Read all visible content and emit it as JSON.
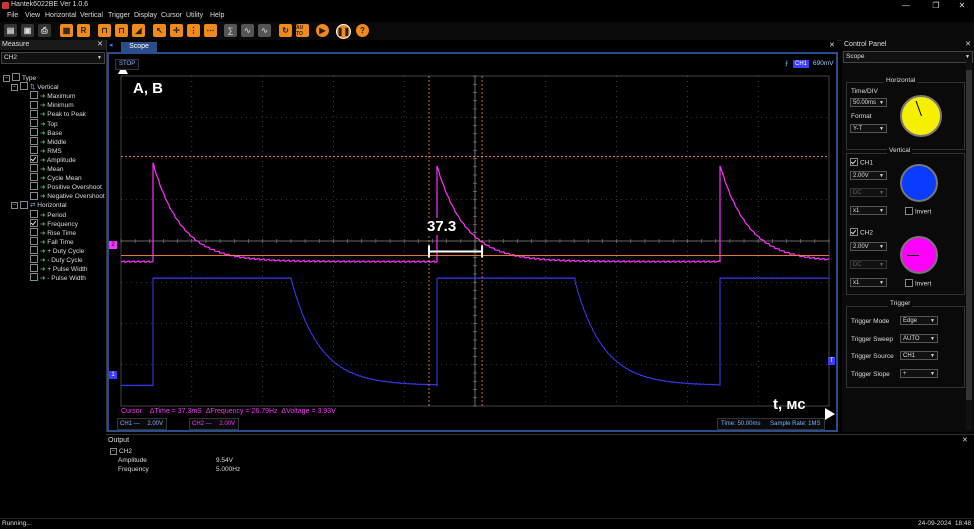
{
  "window": {
    "title": "Hantek6022BE Ver 1.0.6",
    "min": "—",
    "max": "❐",
    "close": "✕"
  },
  "menu": [
    "File",
    "View",
    "Horizontal",
    "Vertical",
    "Trigger",
    "Display",
    "Cursor",
    "Utility",
    "Help"
  ],
  "toolbar": {
    "r_label": "R",
    "auto_label": "AU TO",
    "help_label": "?"
  },
  "measure_panel": {
    "header": "Measure",
    "close": "✕",
    "channel": "CH2",
    "type_label": "Type",
    "vertical_label": "Vertical",
    "horizontal_label": "Horizontal",
    "vertical_items": [
      {
        "label": "Maximum",
        "checked": false
      },
      {
        "label": "Minimum",
        "checked": false
      },
      {
        "label": "Peak to Peak",
        "checked": false
      },
      {
        "label": "Top",
        "checked": false
      },
      {
        "label": "Base",
        "checked": false
      },
      {
        "label": "Middle",
        "checked": false
      },
      {
        "label": "RMS",
        "checked": false
      },
      {
        "label": "Amplitude",
        "checked": true
      },
      {
        "label": "Mean",
        "checked": false
      },
      {
        "label": "Cycle Mean",
        "checked": false
      },
      {
        "label": "Positive Overshoot",
        "checked": false
      },
      {
        "label": "Negative Overshoot",
        "checked": false
      }
    ],
    "horizontal_items": [
      {
        "label": "Period",
        "checked": false
      },
      {
        "label": "Frequency",
        "checked": true
      },
      {
        "label": "Rise Time",
        "checked": false
      },
      {
        "label": "Fall Time",
        "checked": false
      },
      {
        "label": "+ Duty Cycle",
        "checked": false
      },
      {
        "label": "- Duty Cycle",
        "checked": false
      },
      {
        "label": "+ Pulse Width",
        "checked": false
      },
      {
        "label": "- Pulse Width",
        "checked": false
      }
    ]
  },
  "scope": {
    "tab": "Scope",
    "close": "✕",
    "status": "STOP",
    "trigger_channel": "CH1",
    "trigger_level": "690mV",
    "annotation_y": "A, B",
    "annotation_x": "t, мс",
    "annotation_interval": "37.3",
    "cursor_readout": "Cursor    ΔTime = 37.3mS  ΔFrequency = 26.79Hz  ΔVoltage = 3.93V",
    "ch1_label": "CH1 —",
    "ch1_scale": "2.00V",
    "ch2_label": "CH2 —",
    "ch2_scale": "2.00V",
    "time_label": "Time: 50.00ms",
    "sample_rate_label": "Sample Rate: 1MS",
    "ch2_marker": "2",
    "ch1_marker": "1",
    "trig_marker": "T"
  },
  "control_panel": {
    "header": "Control Panel",
    "close": "✕",
    "mode": "Scope",
    "horizontal": {
      "title": "Horizontal",
      "time_div_label": "Time/DIV",
      "time_div": "50.00ms",
      "format_label": "Format",
      "format": "Y-T",
      "knob_color": "#f5f000"
    },
    "vertical": {
      "title": "Vertical",
      "ch1": {
        "label": "CH1",
        "enabled": true,
        "volts": "2.00V",
        "coupling": "DC",
        "probe": "x1",
        "invert_label": "Invert",
        "knob_color": "#0a3cff"
      },
      "ch2": {
        "label": "CH2",
        "enabled": true,
        "volts": "2.00V",
        "coupling": "DC",
        "probe": "x1",
        "invert_label": "Invert",
        "knob_color": "#ff00ff"
      }
    },
    "trigger": {
      "title": "Trigger",
      "mode_label": "Trigger Mode",
      "mode": "Edge",
      "sweep_label": "Trigger Sweep",
      "sweep": "AUTO",
      "source_label": "Trigger Source",
      "source": "CH1",
      "slope_label": "Trigger Slope",
      "slope": "+"
    }
  },
  "output": {
    "header": "Output",
    "close": "✕",
    "channel": "CH2",
    "rows": [
      {
        "name": "Amplitude",
        "value": "9.54V"
      },
      {
        "name": "Frequency",
        "value": "5.000Hz"
      }
    ]
  },
  "status_bar": {
    "text": "Running...",
    "timestamp": "24-09-2024  18:48"
  },
  "colors": {
    "ch1": "#3c3cff",
    "ch2": "#ff30ff",
    "cursor": "#ff8a3c",
    "frame": "#2c4d8c",
    "accent": "#f08a1a"
  },
  "chart_data": {
    "type": "line",
    "xlabel": "t, мс",
    "ylabel": "A, B",
    "x_divisions": 10,
    "y_divisions": 8,
    "series": [
      {
        "name": "CH2",
        "shape": "decaying exponential spikes",
        "period_divisions": 4,
        "edges": [
          0.45,
          4.35,
          8.25
        ],
        "amplitude_divisions": 2.4,
        "tau_divisions": 0.4
      },
      {
        "name": "CH1",
        "shape": "square wave with exponential rise",
        "period_divisions": 4,
        "high_start": [
          0.45,
          4.35,
          8.25
        ],
        "high_end": [
          2.4,
          6.3
        ],
        "high_divisions": 2.6
      }
    ],
    "cursor_delta_time_ms": 37.3,
    "cursor_delta_frequency_hz": 26.79,
    "cursor_delta_voltage_v": 3.93
  }
}
